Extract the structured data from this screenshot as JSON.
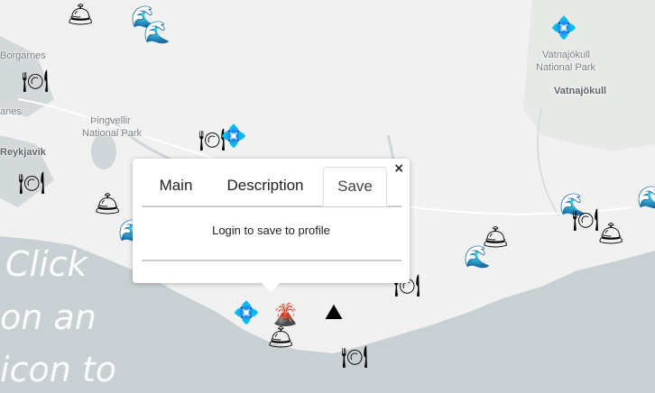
{
  "map_labels": {
    "borgarnes": "Borgarnes",
    "anes": "anes",
    "thingvellir": "Þingvellir",
    "national_park": "National Park",
    "reykjavik": "Reykjavik",
    "vatnajokull_np_1": "Vatnajökull",
    "vatnajokull_np_2": "National Park",
    "vatnajokull": "Vatnajökull"
  },
  "overlay_text": {
    "line1": "Click",
    "line2": "on an",
    "line3": "icon to"
  },
  "popup": {
    "tabs": [
      "Main",
      "Description",
      "Save"
    ],
    "active_tab": "Save",
    "message": "Login to save to profile",
    "close": "×"
  },
  "marker_icons": {
    "bell": "🛎",
    "waves": "🌊",
    "diamond": "💠",
    "plate": "🍽",
    "volcano": "🌋",
    "mountains": "⛰"
  },
  "colors": {
    "land": "#f2f2f2",
    "sea": "#c9d0d3",
    "park": "#e6e9e6"
  }
}
